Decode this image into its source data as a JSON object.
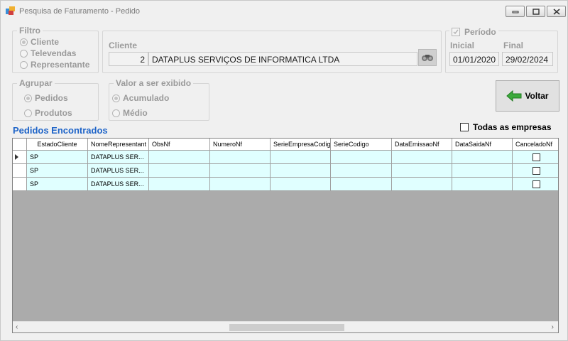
{
  "window": {
    "title": "Pesquisa de Faturamento - Pedido"
  },
  "filtro": {
    "label": "Filtro",
    "options": [
      {
        "label": "Cliente",
        "selected": true
      },
      {
        "label": "Televendas",
        "selected": false
      },
      {
        "label": "Representante",
        "selected": false
      }
    ]
  },
  "cliente": {
    "label": "Cliente",
    "code": "2",
    "name": "DATAPLUS SERVIÇOS DE INFORMATICA LTDA"
  },
  "periodo": {
    "label": "Período",
    "checked": true,
    "inicial_label": "Inicial",
    "inicial": "01/01/2020",
    "final_label": "Final",
    "final": "29/02/2024"
  },
  "agrupar": {
    "label": "Agrupar",
    "options": [
      {
        "label": "Pedidos",
        "selected": true
      },
      {
        "label": "Produtos",
        "selected": false
      }
    ]
  },
  "valor": {
    "label": "Valor a ser exibido",
    "options": [
      {
        "label": "Acumulado",
        "selected": true
      },
      {
        "label": "Médio",
        "selected": false
      }
    ]
  },
  "voltar_label": "Voltar",
  "pedidos_title": "Pedidos Encontrados",
  "todas_empresas": {
    "label": "Todas as empresas",
    "checked": false
  },
  "grid": {
    "columns": [
      "EstadoCliente",
      "NomeRepresentant",
      "ObsNf",
      "NumeroNf",
      "SerieEmpresaCodig",
      "SerieCodigo",
      "DataEmissaoNf",
      "DataSaidaNf",
      "CanceladoNf"
    ],
    "rows": [
      {
        "estado": "SP",
        "representante": "DATAPLUS SER...",
        "obs": "",
        "numero": "",
        "serie_emp": "",
        "serie": "",
        "emissao": "",
        "saida": "",
        "cancelado": false
      },
      {
        "estado": "SP",
        "representante": "DATAPLUS SER...",
        "obs": "",
        "numero": "",
        "serie_emp": "",
        "serie": "",
        "emissao": "",
        "saida": "",
        "cancelado": false
      },
      {
        "estado": "SP",
        "representante": "DATAPLUS SER...",
        "obs": "",
        "numero": "",
        "serie_emp": "",
        "serie": "",
        "emissao": "",
        "saida": "",
        "cancelado": false
      }
    ]
  },
  "icons": {
    "app": "app-icon",
    "search": "binoculars-icon",
    "voltar": "green-arrow-left-icon",
    "row_pointer": "row-pointer-icon"
  }
}
